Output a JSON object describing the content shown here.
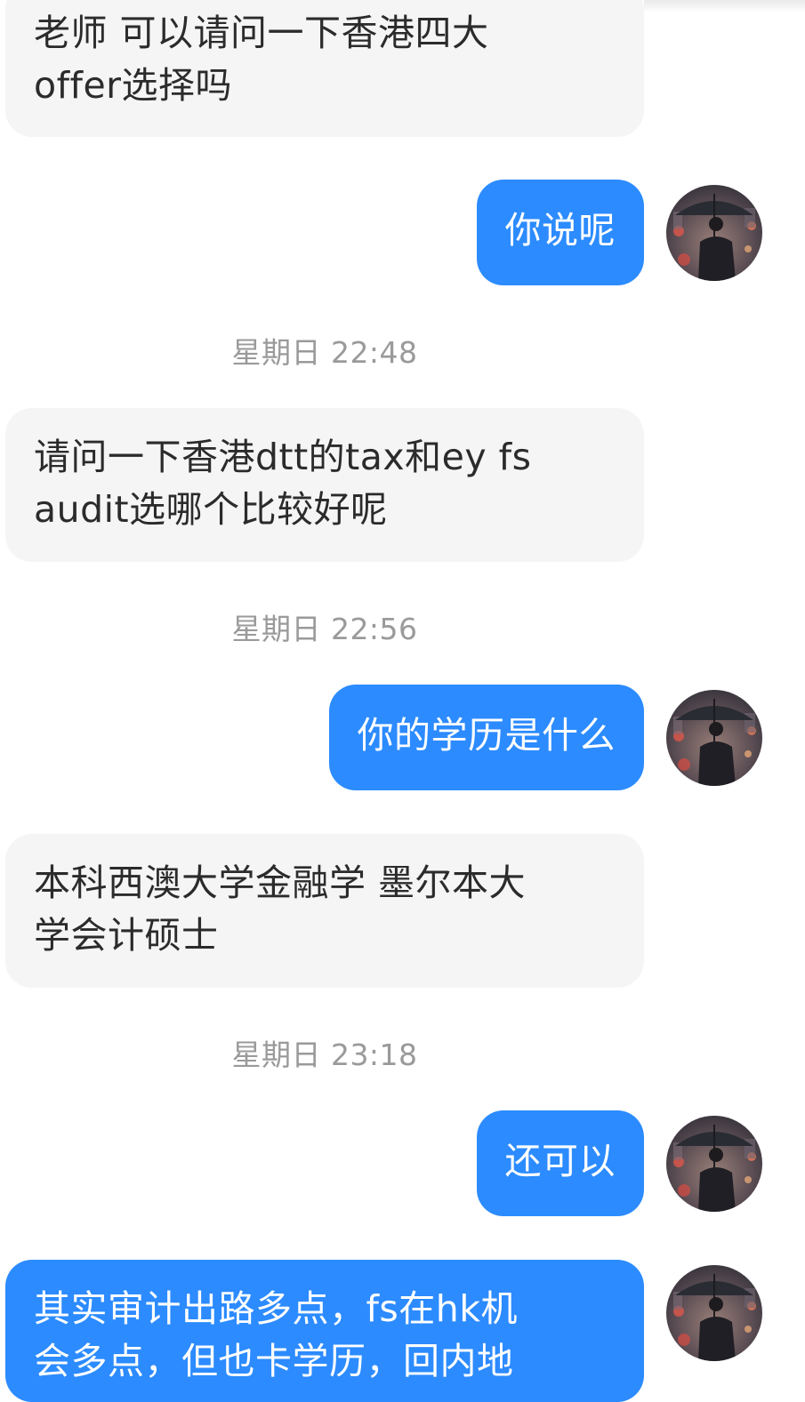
{
  "messages": [
    {
      "lines": [
        "老师 可以请问一下香港四大",
        "offer选择吗"
      ]
    },
    {
      "text": "你说呢"
    },
    {
      "time": "星期日 22:48"
    },
    {
      "lines": [
        "请问一下香港dtt的tax和ey fs",
        "audit选哪个比较好呢"
      ]
    },
    {
      "time": "星期日 22:56"
    },
    {
      "text": "你的学历是什么"
    },
    {
      "lines": [
        "本科西澳大学金融学 墨尔本大",
        "学会计硕士"
      ]
    },
    {
      "time": "星期日 23:18"
    },
    {
      "text": "还可以"
    },
    {
      "lines": [
        "其实审计出路多点，fs在hk机",
        "会多点，但也卡学历，回内地"
      ]
    }
  ],
  "colors": {
    "incoming_bubble": "#f5f5f5",
    "outgoing_bubble": "#2c8bff",
    "timestamp_text": "#9a9a9a"
  },
  "icons": {
    "avatar": "avatar-man-with-umbrella"
  }
}
